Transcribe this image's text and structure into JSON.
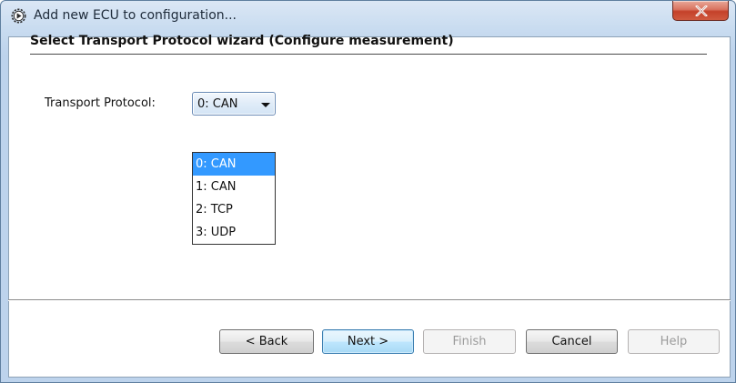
{
  "window": {
    "title": "Add new ECU to configuration...",
    "app_icon": "gear-play-icon",
    "close_icon": "close-icon"
  },
  "wizard": {
    "title": "Select Transport Protocol wizard (Configure measurement)"
  },
  "transport_protocol": {
    "label": "Transport Protocol:",
    "selected": "0: CAN",
    "options": [
      {
        "label": "0: CAN",
        "highlighted": true
      },
      {
        "label": "1: CAN",
        "highlighted": false
      },
      {
        "label": "2: TCP",
        "highlighted": false
      },
      {
        "label": "3: UDP",
        "highlighted": false
      }
    ]
  },
  "buttons": {
    "back": {
      "label": "< Back",
      "enabled": true
    },
    "next": {
      "label": "Next >",
      "enabled": true
    },
    "finish": {
      "label": "Finish",
      "enabled": false
    },
    "cancel": {
      "label": "Cancel",
      "enabled": true
    },
    "help": {
      "label": "Help",
      "enabled": false
    }
  },
  "colors": {
    "selection": "#3399ff",
    "close_button": "#c4412a"
  }
}
